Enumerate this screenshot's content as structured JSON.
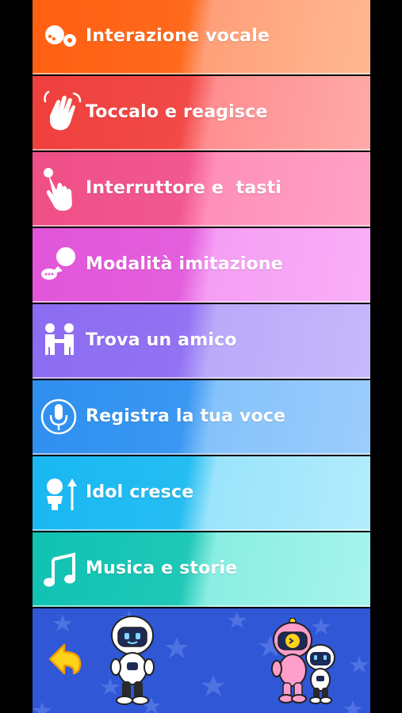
{
  "menu": {
    "items": [
      {
        "label": "Interazione vocale",
        "icon": "speech-bubbles-icon"
      },
      {
        "label": "Toccalo e reagisce",
        "icon": "waving-hand-icon"
      },
      {
        "label": "Interruttore e  tasti",
        "icon": "finger-press-icon"
      },
      {
        "label": "Modalità imitazione",
        "icon": "chat-head-icon"
      },
      {
        "label": "Trova un amico",
        "icon": "two-friends-icon"
      },
      {
        "label": "Registra la tua voce",
        "icon": "microphone-icon"
      },
      {
        "label": "Idol cresce",
        "icon": "child-grow-icon"
      },
      {
        "label": "Musica e storie",
        "icon": "music-note-icon"
      }
    ]
  },
  "footer": {
    "background": "#2f57d6",
    "back_icon": "back-arrow-icon",
    "characters": [
      "white-robot-mascot",
      "pink-robot-mascot",
      "small-white-robot-mascot"
    ]
  }
}
